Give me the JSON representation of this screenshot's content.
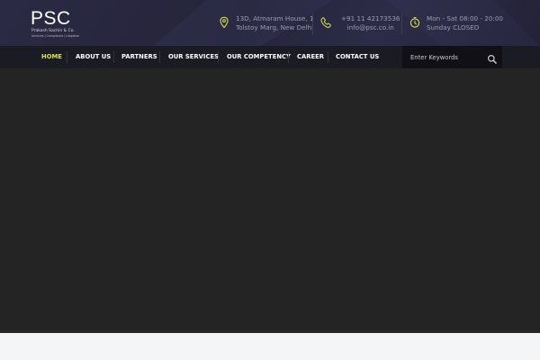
{
  "brand": {
    "logo_text": "PSC",
    "name": "Prakash Sachin & Co.",
    "tagline": "Services | Compliance | Litigation"
  },
  "contact": {
    "address_line1": "13D, Atmaram House, 1",
    "address_line2": "Tolstoy Marg, New Delhi",
    "phone": "+91 11 42173536",
    "email": "info@psc.co.in",
    "hours_line1": "Mon - Sat 08:00 - 20:00",
    "hours_line2": "Sunday CLOSED"
  },
  "nav": {
    "items": [
      {
        "label": "HOME",
        "active": true
      },
      {
        "label": "ABOUT US"
      },
      {
        "label": "PARTNERS"
      },
      {
        "label": "OUR SERVICES"
      },
      {
        "label": "OUR COMPETENCY"
      },
      {
        "label": "CAREER"
      },
      {
        "label": "CONTACT US"
      }
    ]
  },
  "search": {
    "placeholder": "Enter Keywords"
  },
  "icons": {
    "address": "map-pin-icon",
    "phone": "phone-icon",
    "hours": "clock-icon",
    "search": "search-icon"
  },
  "colors": {
    "accent": "#d9e34a",
    "header_bg": "#2b2a44",
    "nav_bg": "#1b1b23",
    "hero_bg": "#242424"
  }
}
